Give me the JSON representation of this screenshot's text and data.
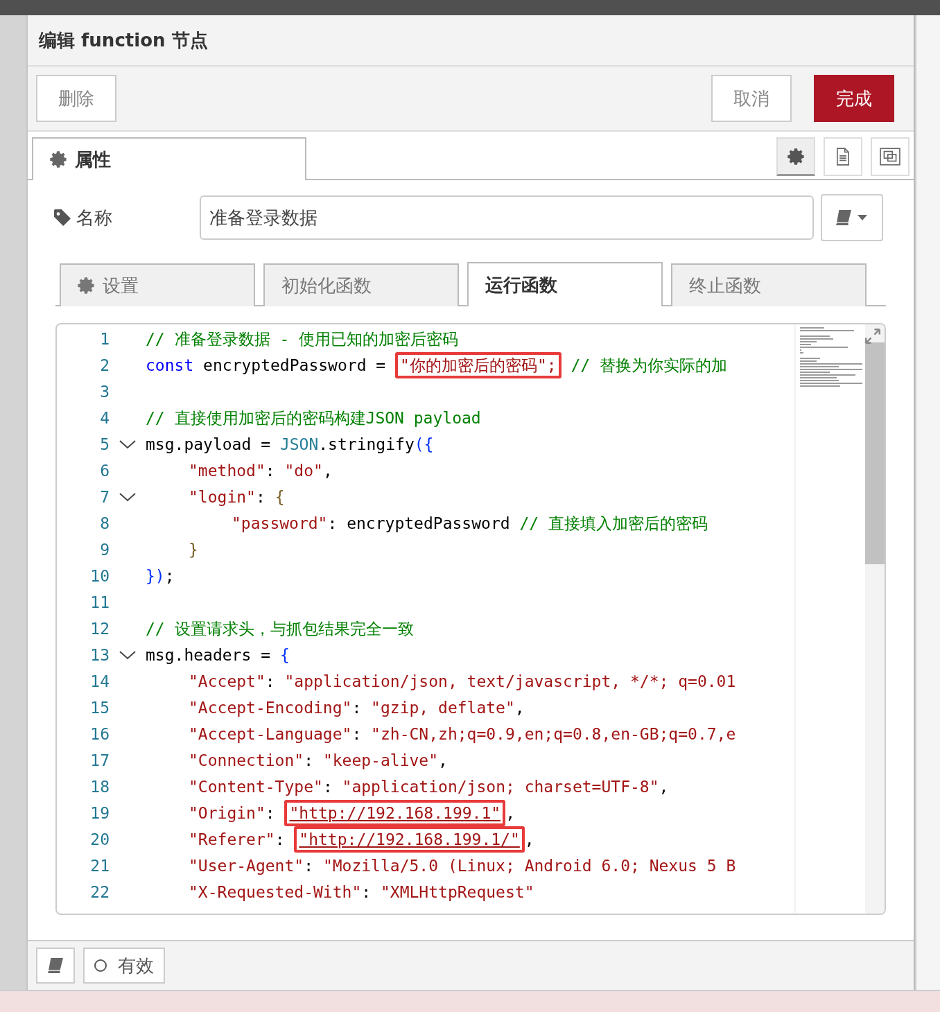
{
  "dialog": {
    "title": "编辑 function 节点"
  },
  "toolbar": {
    "delete": "删除",
    "cancel": "取消",
    "done": "完成"
  },
  "panel_tabs": [
    {
      "label": "属性",
      "kind": "gear",
      "selected": true
    }
  ],
  "panel_icons": [
    {
      "kind": "gear",
      "selected": true
    },
    {
      "kind": "doc",
      "selected": false
    },
    {
      "kind": "frame",
      "selected": false
    }
  ],
  "name_field": {
    "label": "名称",
    "value": "准备登录数据"
  },
  "tabs": [
    {
      "label": "设置",
      "kind": "gear",
      "selected": false
    },
    {
      "label": "初始化函数",
      "kind": "plain",
      "selected": false
    },
    {
      "label": "运行函数",
      "kind": "plain",
      "selected": true
    },
    {
      "label": "终止函数",
      "kind": "plain",
      "selected": false
    }
  ],
  "code_lines": [
    {
      "number": "1",
      "kind": "root",
      "tokens": [
        {
          "kind": "comment",
          "text": "// 准备登录数据 - 使用已知的加密后密码"
        }
      ]
    },
    {
      "number": "2",
      "kind": "root",
      "tokens": [
        {
          "kind": "keyword",
          "text": "const"
        },
        {
          "kind": "plain",
          "text": " encryptedPassword = "
        },
        {
          "kind": "string",
          "text": "\"你的加密后的密码\";",
          "boxed": true
        },
        {
          "kind": "comment",
          "text": " // 替换为你实际的加"
        }
      ]
    },
    {
      "number": "3"
    },
    {
      "number": "4",
      "kind": "root",
      "tokens": [
        {
          "kind": "comment",
          "text": "// 直接使用加密后的密码构建JSON payload"
        }
      ]
    },
    {
      "number": "5",
      "kind": "root",
      "foldable": true,
      "tokens": [
        {
          "kind": "plain",
          "text": "msg.payload = "
        },
        {
          "kind": "type",
          "text": "JSON"
        },
        {
          "kind": "plain",
          "text": ".stringify"
        },
        {
          "kind": "bracket",
          "text": "({"
        }
      ]
    },
    {
      "number": "6",
      "kind": "inner",
      "tokens": [
        {
          "kind": "string",
          "text": "\"method\""
        },
        {
          "kind": "plain",
          "text": ": "
        },
        {
          "kind": "string",
          "text": "\"do\""
        },
        {
          "kind": "plain",
          "text": ","
        }
      ]
    },
    {
      "number": "7",
      "kind": "inner",
      "foldable": true,
      "tokens": [
        {
          "kind": "string",
          "text": "\"login\""
        },
        {
          "kind": "plain",
          "text": ": "
        },
        {
          "kind": "brace",
          "text": "{"
        }
      ]
    },
    {
      "number": "8",
      "kind": "deep",
      "tokens": [
        {
          "kind": "string",
          "text": "\"password\""
        },
        {
          "kind": "plain",
          "text": ": encryptedPassword "
        },
        {
          "kind": "comment",
          "text": "// 直接填入加密后的密码"
        }
      ]
    },
    {
      "number": "9",
      "kind": "inner",
      "tokens": [
        {
          "kind": "brace",
          "text": "}"
        }
      ]
    },
    {
      "number": "10",
      "kind": "root",
      "tokens": [
        {
          "kind": "bracket",
          "text": "})"
        },
        {
          "kind": "plain",
          "text": ";"
        }
      ]
    },
    {
      "number": "11"
    },
    {
      "number": "12",
      "kind": "root",
      "tokens": [
        {
          "kind": "comment",
          "text": "// 设置请求头，与抓包结果完全一致"
        }
      ]
    },
    {
      "number": "13",
      "kind": "root",
      "foldable": true,
      "tokens": [
        {
          "kind": "plain",
          "text": "msg.headers = "
        },
        {
          "kind": "bracket",
          "text": "{"
        }
      ]
    },
    {
      "number": "14",
      "kind": "inner",
      "tokens": [
        {
          "kind": "string",
          "text": "\"Accept\""
        },
        {
          "kind": "plain",
          "text": ": "
        },
        {
          "kind": "string",
          "text": "\"application/json, text/javascript, */*; q=0.01"
        }
      ]
    },
    {
      "number": "15",
      "kind": "inner",
      "tokens": [
        {
          "kind": "string",
          "text": "\"Accept-Encoding\""
        },
        {
          "kind": "plain",
          "text": ": "
        },
        {
          "kind": "string",
          "text": "\"gzip, deflate\""
        },
        {
          "kind": "plain",
          "text": ","
        }
      ]
    },
    {
      "number": "16",
      "kind": "inner",
      "tokens": [
        {
          "kind": "string",
          "text": "\"Accept-Language\""
        },
        {
          "kind": "plain",
          "text": ": "
        },
        {
          "kind": "string",
          "text": "\"zh-CN,zh;q=0.9,en;q=0.8,en-GB;q=0.7,e"
        }
      ]
    },
    {
      "number": "17",
      "kind": "inner",
      "tokens": [
        {
          "kind": "string",
          "text": "\"Connection\""
        },
        {
          "kind": "plain",
          "text": ": "
        },
        {
          "kind": "string",
          "text": "\"keep-alive\""
        },
        {
          "kind": "plain",
          "text": ","
        }
      ]
    },
    {
      "number": "18",
      "kind": "inner",
      "tokens": [
        {
          "kind": "string",
          "text": "\"Content-Type\""
        },
        {
          "kind": "plain",
          "text": ": "
        },
        {
          "kind": "string",
          "text": "\"application/json; charset=UTF-8\""
        },
        {
          "kind": "plain",
          "text": ","
        }
      ]
    },
    {
      "number": "19",
      "kind": "inner",
      "tokens": [
        {
          "kind": "string",
          "text": "\"Origin\""
        },
        {
          "kind": "plain",
          "text": ": "
        },
        {
          "kind": "url",
          "text": "\"http://192.168.199.1\"",
          "boxed": true
        },
        {
          "kind": "plain",
          "text": ","
        }
      ]
    },
    {
      "number": "20",
      "kind": "inner",
      "tokens": [
        {
          "kind": "string",
          "text": "\"Referer\""
        },
        {
          "kind": "plain",
          "text": ": "
        },
        {
          "kind": "url",
          "text": "\"http://192.168.199.1/\"",
          "boxed": true
        },
        {
          "kind": "plain",
          "text": ","
        }
      ]
    },
    {
      "number": "21",
      "kind": "inner",
      "tokens": [
        {
          "kind": "string",
          "text": "\"User-Agent\""
        },
        {
          "kind": "plain",
          "text": ": "
        },
        {
          "kind": "string",
          "text": "\"Mozilla/5.0 (Linux; Android 6.0; Nexus 5 B"
        }
      ]
    },
    {
      "number": "22",
      "kind": "inner",
      "tokens": [
        {
          "kind": "string",
          "text": "\"X-Requested-With\""
        },
        {
          "kind": "plain",
          "text": ": "
        },
        {
          "kind": "string",
          "text": "\"XMLHttpRequest\""
        }
      ]
    }
  ],
  "footer": {
    "enabled": {
      "label": "有效",
      "checked": false
    }
  }
}
